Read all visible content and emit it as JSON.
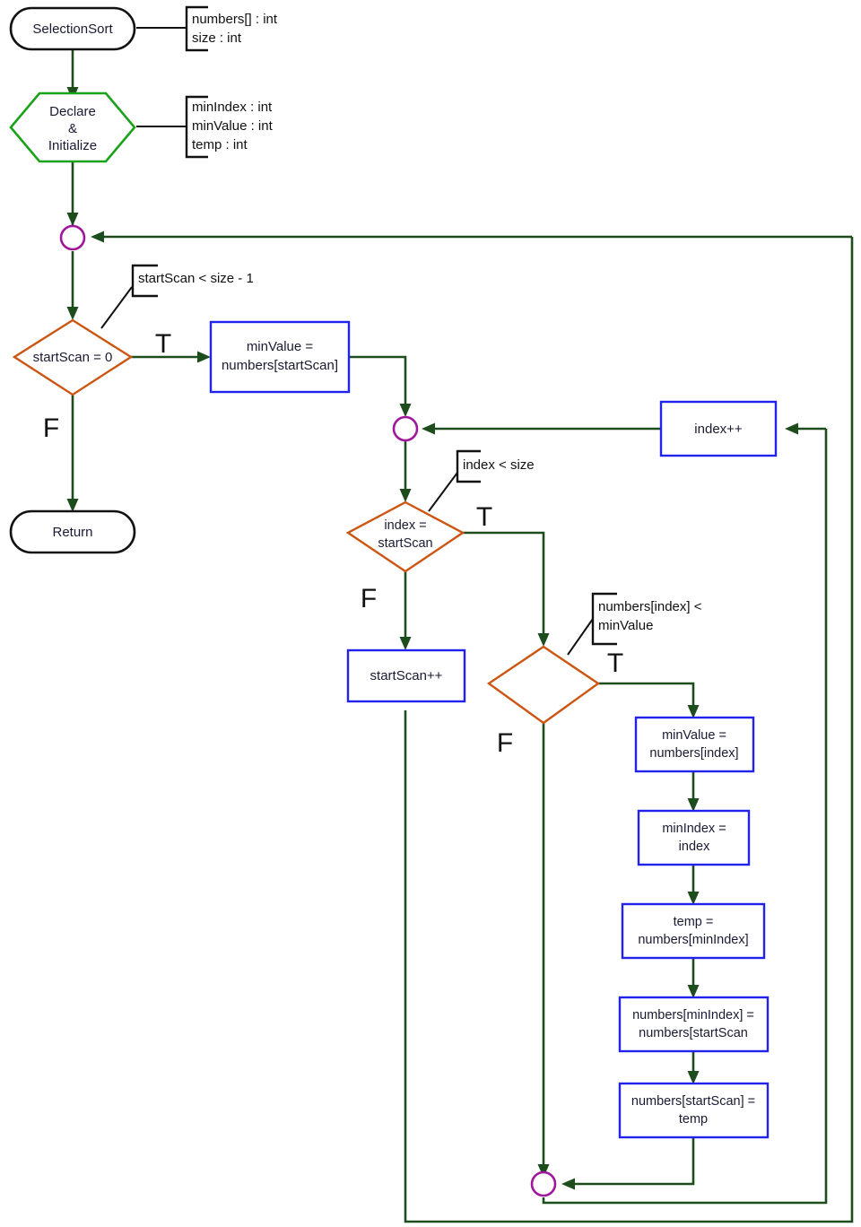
{
  "diagram": {
    "title": "SelectionSort Flowchart",
    "colors": {
      "terminator_stroke": "#111111",
      "declare_stroke": "#1aa31a",
      "process_stroke": "#2222ee",
      "decision_stroke": "#cc5511",
      "merge_stroke": "#a0179c",
      "flowline": "#1d4d1d",
      "background": "#ffffff"
    }
  },
  "nodes": {
    "start": {
      "label": "SelectionSort",
      "shape": "terminator"
    },
    "declare": {
      "line1": "Declare",
      "line2": "&",
      "line3": "Initialize",
      "shape": "hexagon"
    },
    "merge_outer": {
      "label": "",
      "shape": "connector"
    },
    "decision_start_scan": {
      "line1": "startScan = 0",
      "line2": "",
      "shape": "decision"
    },
    "return": {
      "label": "Return",
      "shape": "terminator"
    },
    "min_value_start": {
      "line1": "minValue =",
      "line2": "numbers[startScan]",
      "shape": "process"
    },
    "merge_inner": {
      "label": "",
      "shape": "connector"
    },
    "decision_index": {
      "line1": "index =",
      "line2": "startScan",
      "shape": "decision"
    },
    "index_inc": {
      "line1": "index++",
      "line2": "",
      "shape": "process"
    },
    "start_scan_inc": {
      "line1": "startScan++",
      "line2": "",
      "shape": "process"
    },
    "decision_compare": {
      "line1": "",
      "line2": "",
      "shape": "decision"
    },
    "min_value_index": {
      "line1": "minValue =",
      "line2": "numbers[index]",
      "shape": "process"
    },
    "min_index_assign": {
      "line1": "minIndex =",
      "line2": "index",
      "shape": "process"
    },
    "temp_assign": {
      "line1": "temp =",
      "line2": "numbers[minIndex]",
      "shape": "process"
    },
    "swap_min": {
      "line1": "numbers[minIndex] =",
      "line2": "numbers[startScan",
      "shape": "process"
    },
    "swap_start": {
      "line1": "numbers[startScan] =",
      "line2": "temp",
      "shape": "process"
    },
    "merge_bottom": {
      "label": "",
      "shape": "connector"
    }
  },
  "comments": {
    "params": {
      "line1": "numbers[] : int",
      "line2": "size : int"
    },
    "locals": {
      "line1": "minIndex : int",
      "line2": "minValue : int",
      "line3": "temp : int"
    },
    "loop_outer": {
      "line1": "startScan < size - 1",
      "line2": ""
    },
    "loop_inner": {
      "line1": "index < size",
      "line2": ""
    },
    "compare": {
      "line1": "numbers[index] <",
      "line2": "minValue"
    }
  },
  "branch_labels": {
    "outer_true": "T",
    "outer_false": "F",
    "inner_true": "T",
    "inner_false": "F",
    "compare_true": "T",
    "compare_false": "F"
  }
}
